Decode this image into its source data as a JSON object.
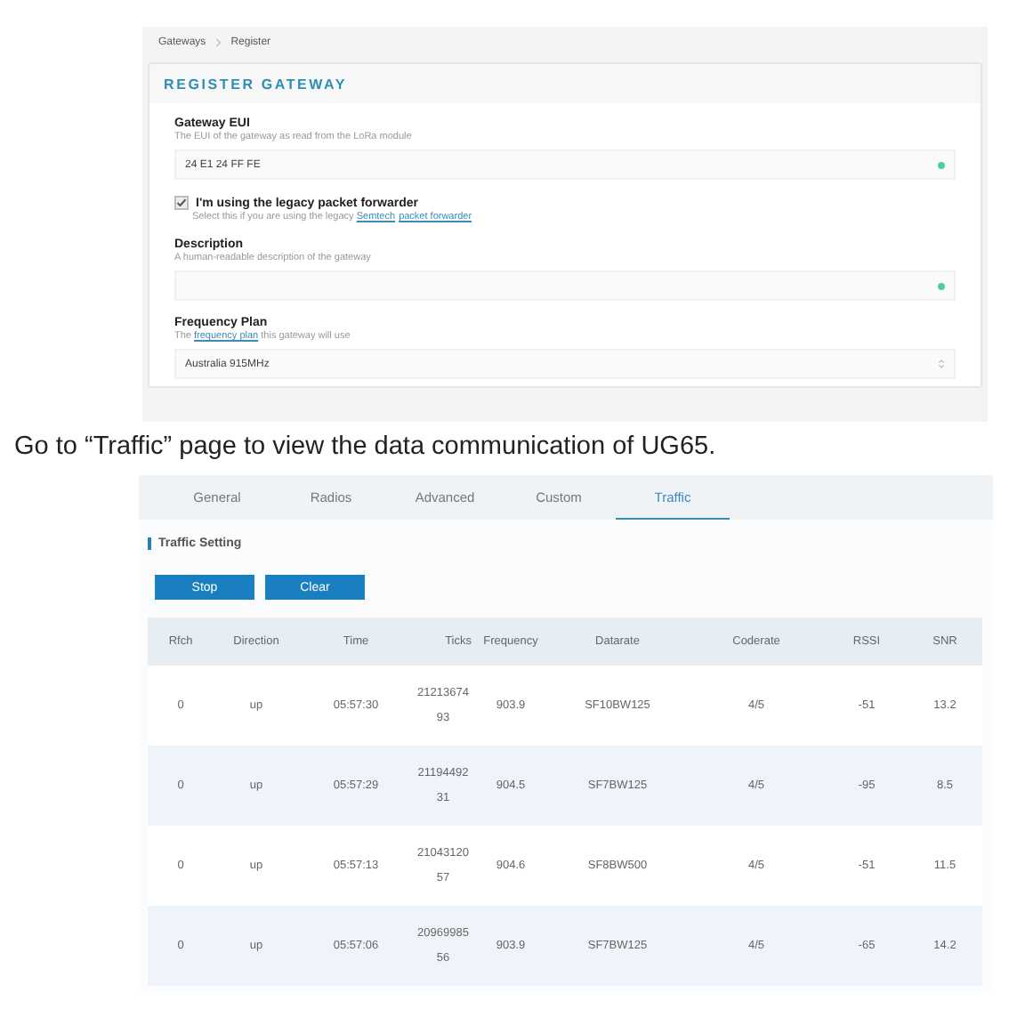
{
  "register_screen": {
    "breadcrumb": [
      "Gateways",
      "Register"
    ],
    "title": "REGISTER GATEWAY",
    "fields": [
      {
        "kind": "input",
        "label": "Gateway EUI",
        "hint": [
          {
            "kind": "text",
            "text": "The EUI of the gateway as read from the LoRa module"
          }
        ],
        "value": "24 E1 24 FF FE"
      },
      {
        "kind": "checkbox",
        "label": "I'm using the legacy packet forwarder",
        "checked": true,
        "hint": [
          {
            "kind": "text",
            "text": "Select this if you are using the legacy "
          },
          {
            "kind": "link",
            "text": "Semtech"
          },
          {
            "kind": "link",
            "text": "packet forwarder"
          }
        ]
      },
      {
        "kind": "input",
        "label": "Description",
        "hint": [
          {
            "kind": "text",
            "text": "A human-readable description of the gateway"
          }
        ]
      },
      {
        "kind": "select",
        "label": "Frequency Plan",
        "hint": [
          {
            "kind": "text",
            "text": "The "
          },
          {
            "kind": "link",
            "text": "frequency plan"
          },
          {
            "kind": "text",
            "text": " this gateway will use"
          }
        ],
        "value": "Australia 915MHz"
      }
    ]
  },
  "instruction": "Go to “Traffic” page to view the data communication of UG65.",
  "traffic_screen": {
    "tabs": [
      {
        "label": "General",
        "selected": false
      },
      {
        "label": "Radios",
        "selected": false
      },
      {
        "label": "Advanced",
        "selected": false
      },
      {
        "label": "Custom",
        "selected": false
      },
      {
        "label": "Traffic",
        "selected": true
      }
    ],
    "section_title": "Traffic Setting",
    "buttons": [
      "Stop",
      "Clear"
    ],
    "table": {
      "columns": [
        "Rfch",
        "Direction",
        "Time",
        "Ticks",
        "Frequency",
        "Datarate",
        "Coderate",
        "RSSI",
        "SNR"
      ],
      "rows": [
        [
          "0",
          "up",
          "05:57:30",
          "2121367493",
          "903.9",
          "SF10BW125",
          "4/5",
          "-51",
          "13.2"
        ],
        [
          "0",
          "up",
          "05:57:29",
          "2119449231",
          "904.5",
          "SF7BW125",
          "4/5",
          "-95",
          "8.5"
        ],
        [
          "0",
          "up",
          "05:57:13",
          "2104312057",
          "904.6",
          "SF8BW500",
          "4/5",
          "-51",
          "11.5"
        ],
        [
          "0",
          "up",
          "05:57:06",
          "2096998556",
          "903.9",
          "SF7BW125",
          "4/5",
          "-65",
          "14.2"
        ]
      ]
    }
  }
}
